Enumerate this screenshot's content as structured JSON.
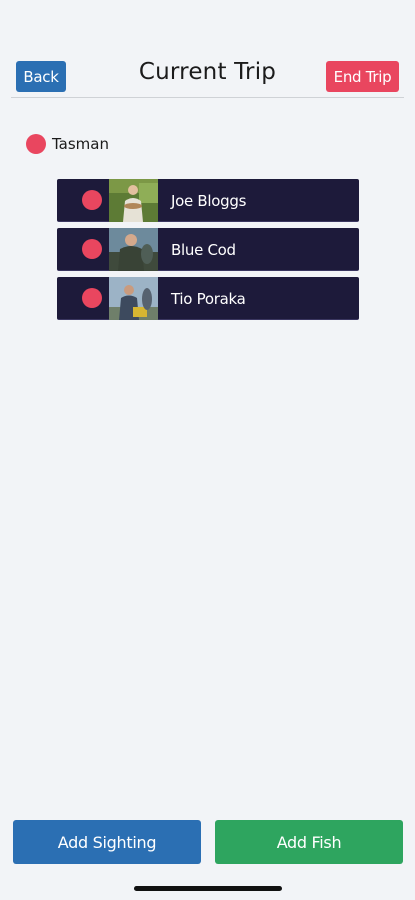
{
  "header": {
    "back_label": "Back",
    "title": "Current Trip",
    "end_label": "End Trip"
  },
  "group": {
    "label": "Tasman",
    "dot_color": "#e9465f"
  },
  "people": [
    {
      "name": "Joe Bloggs",
      "dot_color": "#e9465f"
    },
    {
      "name": "Blue Cod",
      "dot_color": "#e9465f"
    },
    {
      "name": "Tio Poraka",
      "dot_color": "#e9465f"
    }
  ],
  "actions": {
    "sighting_label": "Add Sighting",
    "fish_label": "Add Fish"
  },
  "colors": {
    "primary_blue": "#2b6fb3",
    "danger_red": "#e9465f",
    "success_green": "#2ea55f",
    "row_bg": "#1d1a3a",
    "page_bg": "#f2f4f7"
  }
}
